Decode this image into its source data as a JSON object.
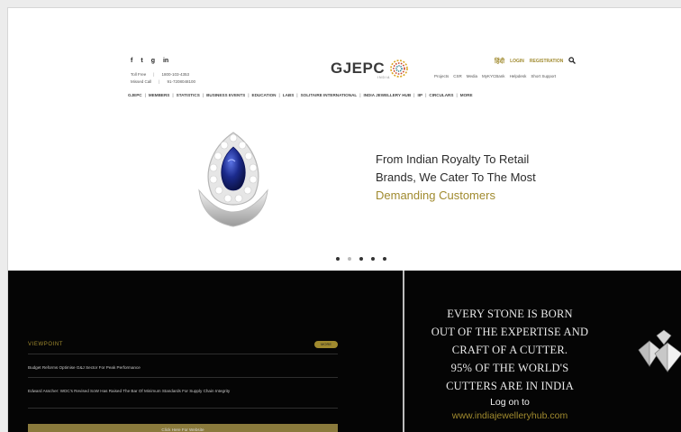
{
  "header": {
    "social_icons": [
      "f",
      "t",
      "g",
      "in"
    ],
    "tollfree_label": "Toll Free",
    "tollfree_value": "1800-103-4353",
    "missed_label": "Missed Call",
    "missed_value": "91-7208048100",
    "logo_text": "GJEPC",
    "logo_sub": "INDIA",
    "hindi_link": "हिंदी",
    "login_link": "LOGIN",
    "register_link": "REGISTRATION",
    "sublinks": [
      "Projects",
      "CSR",
      "Media",
      "MyKYCBank",
      "Helpdesk",
      "Short Support"
    ],
    "nav": [
      "GJEPC",
      "MEMBERS",
      "STATISTICS",
      "BUSINESS EVENTS",
      "EDUCATION",
      "LABS",
      "SOLITAIRE INTERNATIONAL",
      "INDIA JEWELLERY HUB",
      "IIP",
      "CIRCULARS",
      "MORE"
    ]
  },
  "hero": {
    "line1": "From Indian Royalty To Retail",
    "line2": "Brands, We Cater To The Most",
    "line3": "Demanding Customers",
    "dots_count": 5,
    "active_dot": 0
  },
  "viewpoint": {
    "title": "VIEWPOINT",
    "badge": "MORE",
    "items": [
      "Budget Reforms Optimise G&J Sector For Peak Performance",
      "Edward Asscher: WDC's Revised SoW Has Raised The Bar Of Minimum Standards For Supply Chain Integrity"
    ],
    "button_label": "Click Here For Website"
  },
  "ad": {
    "lines": [
      "EVERY STONE IS BORN",
      "OUT OF THE EXPERTISE AND",
      "CRAFT OF A CUTTER.",
      "95% OF THE WORLD'S",
      "CUTTERS ARE IN INDIA"
    ],
    "logon": "Log on to",
    "url": "www.indiajewelleryhub.com"
  },
  "colors": {
    "gold": "#a08a2e",
    "dark": "#050505",
    "sapphire": "#1b2a8c"
  }
}
